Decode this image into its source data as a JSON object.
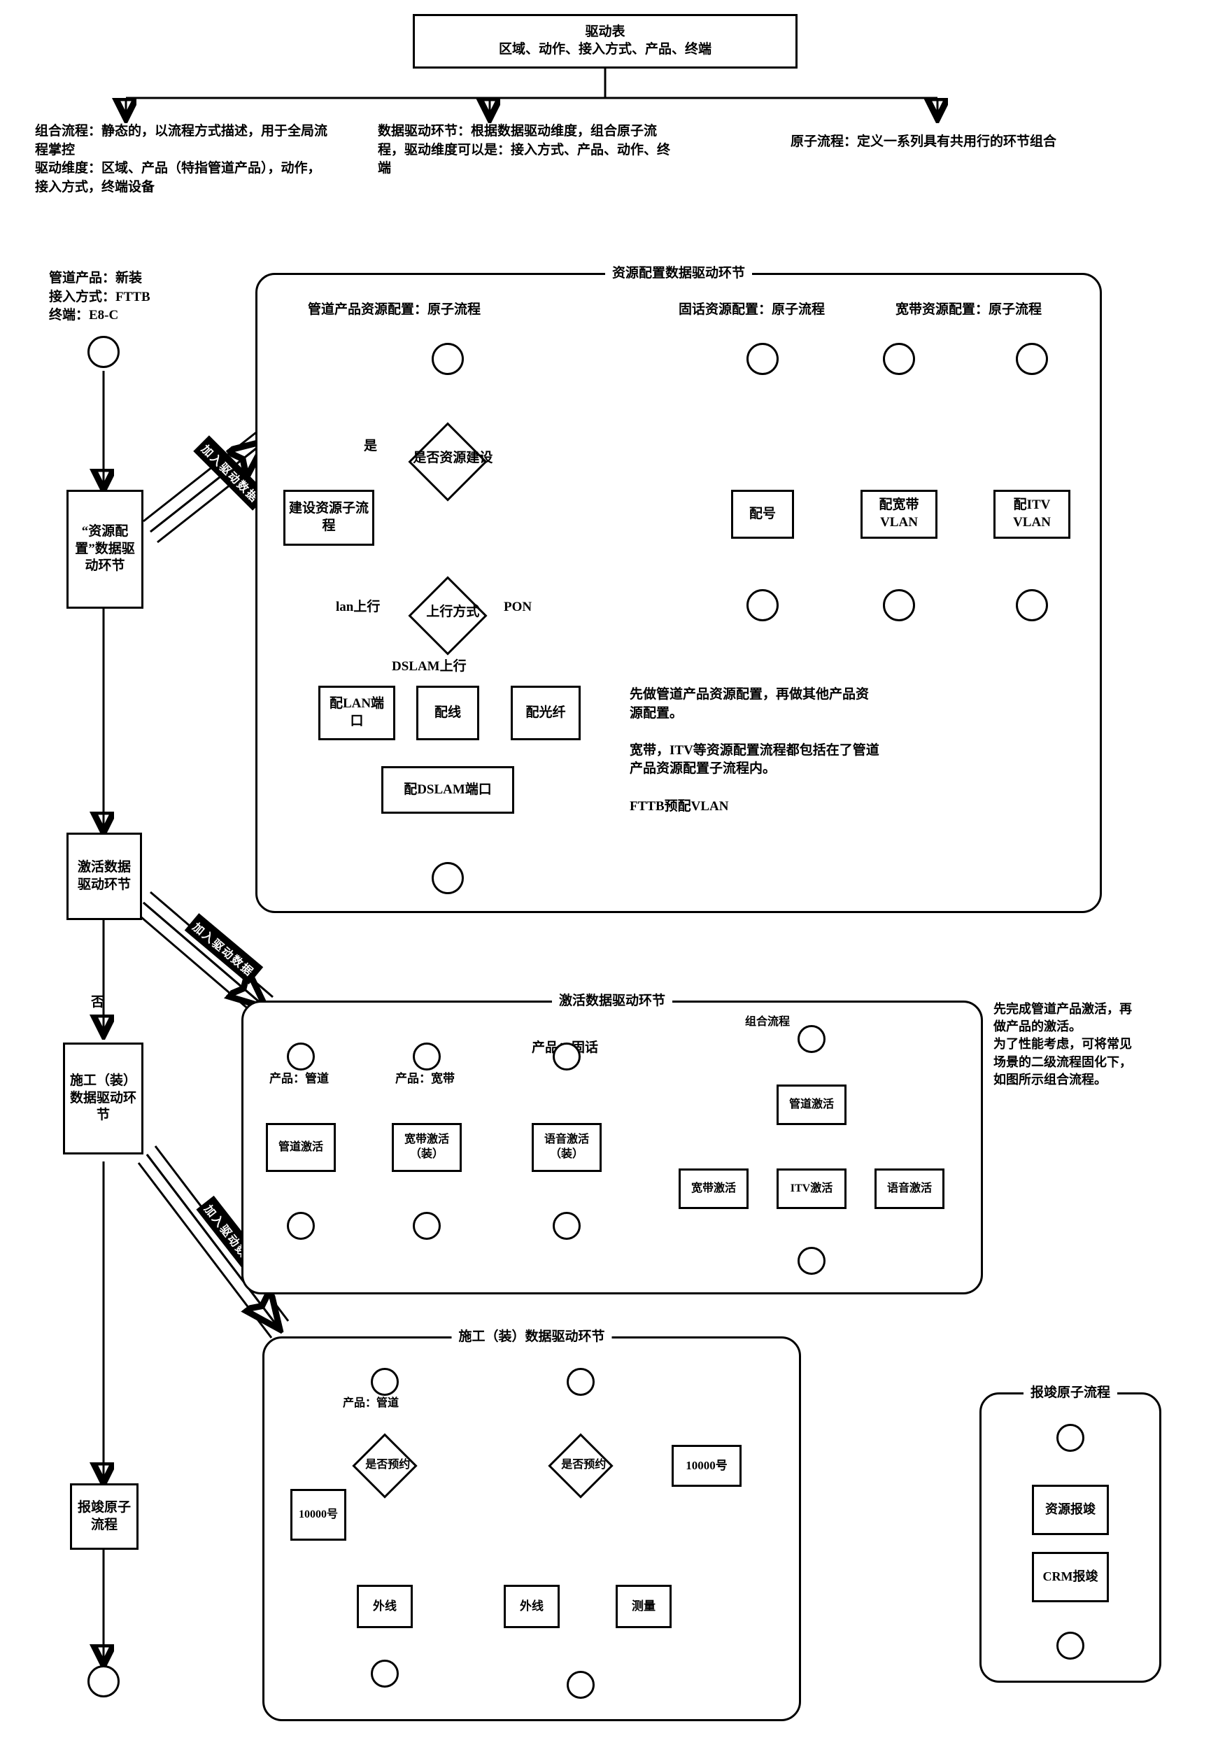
{
  "header": {
    "title_l1": "驱动表",
    "title_l2": "区域、动作、接入方式、产品、终端"
  },
  "top_notes": {
    "left": "组合流程：静态的，以流程方式描述，用于全局流程掌控\n驱动维度：区域、产品（特指管道产品），动作，接入方式，终端设备",
    "mid": "数据驱动环节：根据数据驱动维度，组合原子流程，驱动维度可以是：接入方式、产品、动作、终端",
    "right": "原子流程：定义一系列具有共用行的环节组合"
  },
  "left_col": {
    "params": "管道产品：新装\n接入方式：FTTB\n终端：E8-C",
    "step1": "“资源配置”数据驱动环节",
    "step2": "激活数据驱动环节",
    "no_label": "否",
    "step3": "施工（装）数据驱动环节",
    "step4": "报竣原子流程"
  },
  "tags": {
    "t1": "加入驱动数据",
    "t2": "加入驱动数据",
    "t3": "加入驱动数据"
  },
  "panel1": {
    "title": "资源配置数据驱动环节",
    "h1": "管道产品资源配置：原子流程",
    "h2": "固话资源配置：原子流程",
    "h3": "宽带资源配置：原子流程",
    "d1": "是否资源建设",
    "yes": "是",
    "b_build": "建设资源子流程",
    "d2": "上行方式",
    "lbl_lan": "lan上行",
    "lbl_dslam": "DSLAM上行",
    "lbl_pon": "PON",
    "b_lan": "配LAN端口",
    "b_line": "配线",
    "b_fiber": "配光纤",
    "b_dslam": "配DSLAM端口",
    "b_num": "配号",
    "b_vlan": "配宽带VLAN",
    "b_itv": "配ITV VLAN",
    "note": "先做管道产品资源配置，再做其他产品资源配置。\n\n宽带，ITV等资源配置流程都包括在了管道产品资源配置子流程内。\n\nFTTB预配VLAN"
  },
  "panel2": {
    "title": "激活数据驱动环节",
    "p1": "产品：管道",
    "p2": "产品：宽带",
    "p3": "产品：固话",
    "b1": "管道激活",
    "b2": "宽带激活（装）",
    "b3": "语音激活（装）",
    "combo_lbl": "组合流程",
    "c_root": "管道激活",
    "c_bb": "宽带激活",
    "c_itv": "ITV激活",
    "c_voice": "语音激活",
    "note": "先完成管道产品激活，再做产品的激活。\n为了性能考虑，可将常见场景的二级流程固化下，如图所示组合流程。"
  },
  "panel3": {
    "title": "施工（装）数据驱动环节",
    "p1": "产品：管道",
    "d1": "是否预约",
    "d2": "是否预约",
    "b_10000a": "10000号",
    "b_10000b": "10000号",
    "b_out1": "外线",
    "b_out2": "外线",
    "b_meas": "测量"
  },
  "panel4": {
    "title": "报竣原子流程",
    "b1": "资源报竣",
    "b2": "CRM报竣"
  }
}
